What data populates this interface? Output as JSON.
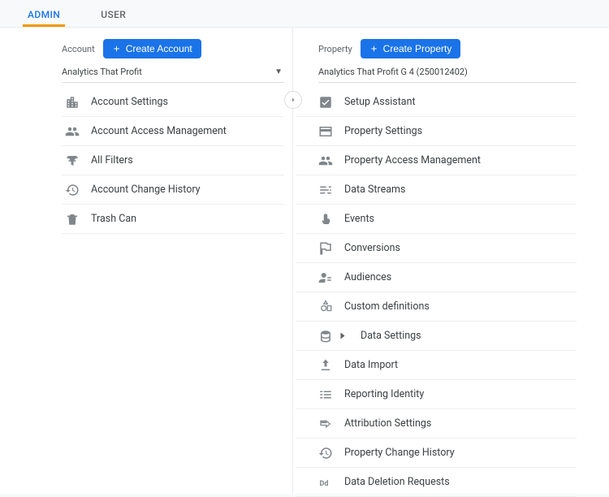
{
  "tabs": {
    "admin": "ADMIN",
    "user": "USER"
  },
  "account": {
    "header_label": "Account",
    "create_button": "Create Account",
    "selected": "Analytics That Profit",
    "items": [
      {
        "label": "Account Settings"
      },
      {
        "label": "Account Access Management"
      },
      {
        "label": "All Filters"
      },
      {
        "label": "Account Change History"
      },
      {
        "label": "Trash Can"
      }
    ]
  },
  "property": {
    "header_label": "Property",
    "create_button": "Create Property",
    "selected": "Analytics That Profit G 4 (250012402)",
    "items": [
      {
        "label": "Setup Assistant"
      },
      {
        "label": "Property Settings"
      },
      {
        "label": "Property Access Management"
      },
      {
        "label": "Data Streams"
      },
      {
        "label": "Events"
      },
      {
        "label": "Conversions"
      },
      {
        "label": "Audiences"
      },
      {
        "label": "Custom definitions"
      },
      {
        "label": "Data Settings"
      },
      {
        "label": "Data Import"
      },
      {
        "label": "Reporting Identity"
      },
      {
        "label": "Attribution Settings"
      },
      {
        "label": "Property Change History"
      },
      {
        "label": "Data Deletion Requests"
      }
    ]
  }
}
